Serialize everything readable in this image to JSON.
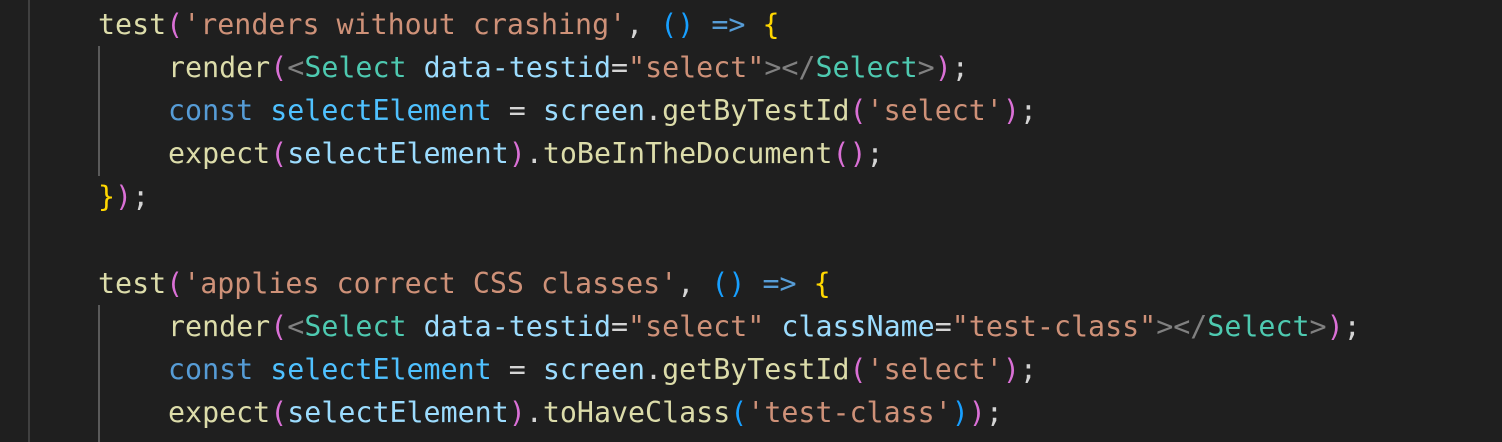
{
  "lines": [
    [
      {
        "text": "test",
        "color": "#dcdcaa"
      },
      {
        "text": "(",
        "color": "#da70d6"
      },
      {
        "text": "'renders without crashing'",
        "color": "#ce9178"
      },
      {
        "text": ", ",
        "color": "#d4d4d4"
      },
      {
        "text": "()",
        "color": "#179fff"
      },
      {
        "text": " ",
        "color": "#d4d4d4"
      },
      {
        "text": "=>",
        "color": "#569cd6"
      },
      {
        "text": " ",
        "color": "#d4d4d4"
      },
      {
        "text": "{",
        "color": "#ffd700"
      }
    ],
    [
      {
        "text": "render",
        "color": "#dcdcaa"
      },
      {
        "text": "(",
        "color": "#da70d6"
      },
      {
        "text": "<",
        "color": "#808080"
      },
      {
        "text": "Select",
        "color": "#4ec9b0"
      },
      {
        "text": " ",
        "color": "#d4d4d4"
      },
      {
        "text": "data-testid",
        "color": "#9cdcfe"
      },
      {
        "text": "=",
        "color": "#d4d4d4"
      },
      {
        "text": "\"select\"",
        "color": "#ce9178"
      },
      {
        "text": "></",
        "color": "#808080"
      },
      {
        "text": "Select",
        "color": "#4ec9b0"
      },
      {
        "text": ">",
        "color": "#808080"
      },
      {
        "text": ")",
        "color": "#da70d6"
      },
      {
        "text": ";",
        "color": "#d4d4d4"
      }
    ],
    [
      {
        "text": "const",
        "color": "#569cd6"
      },
      {
        "text": " ",
        "color": "#d4d4d4"
      },
      {
        "text": "selectElement",
        "color": "#4fc1ff"
      },
      {
        "text": " = ",
        "color": "#d4d4d4"
      },
      {
        "text": "screen",
        "color": "#9cdcfe"
      },
      {
        "text": ".",
        "color": "#d4d4d4"
      },
      {
        "text": "getByTestId",
        "color": "#dcdcaa"
      },
      {
        "text": "(",
        "color": "#da70d6"
      },
      {
        "text": "'select'",
        "color": "#ce9178"
      },
      {
        "text": ")",
        "color": "#da70d6"
      },
      {
        "text": ";",
        "color": "#d4d4d4"
      }
    ],
    [
      {
        "text": "expect",
        "color": "#dcdcaa"
      },
      {
        "text": "(",
        "color": "#da70d6"
      },
      {
        "text": "selectElement",
        "color": "#9cdcfe"
      },
      {
        "text": ")",
        "color": "#da70d6"
      },
      {
        "text": ".",
        "color": "#d4d4d4"
      },
      {
        "text": "toBeInTheDocument",
        "color": "#dcdcaa"
      },
      {
        "text": "()",
        "color": "#da70d6"
      },
      {
        "text": ";",
        "color": "#d4d4d4"
      }
    ],
    [
      {
        "text": "}",
        "color": "#ffd700"
      },
      {
        "text": ")",
        "color": "#da70d6"
      },
      {
        "text": ";",
        "color": "#d4d4d4"
      }
    ],
    [],
    [
      {
        "text": "test",
        "color": "#dcdcaa"
      },
      {
        "text": "(",
        "color": "#da70d6"
      },
      {
        "text": "'applies correct CSS classes'",
        "color": "#ce9178"
      },
      {
        "text": ", ",
        "color": "#d4d4d4"
      },
      {
        "text": "()",
        "color": "#179fff"
      },
      {
        "text": " ",
        "color": "#d4d4d4"
      },
      {
        "text": "=>",
        "color": "#569cd6"
      },
      {
        "text": " ",
        "color": "#d4d4d4"
      },
      {
        "text": "{",
        "color": "#ffd700"
      }
    ],
    [
      {
        "text": "render",
        "color": "#dcdcaa"
      },
      {
        "text": "(",
        "color": "#da70d6"
      },
      {
        "text": "<",
        "color": "#808080"
      },
      {
        "text": "Select",
        "color": "#4ec9b0"
      },
      {
        "text": " ",
        "color": "#d4d4d4"
      },
      {
        "text": "data-testid",
        "color": "#9cdcfe"
      },
      {
        "text": "=",
        "color": "#d4d4d4"
      },
      {
        "text": "\"select\"",
        "color": "#ce9178"
      },
      {
        "text": " ",
        "color": "#d4d4d4"
      },
      {
        "text": "className",
        "color": "#9cdcfe"
      },
      {
        "text": "=",
        "color": "#d4d4d4"
      },
      {
        "text": "\"test-class\"",
        "color": "#ce9178"
      },
      {
        "text": "></",
        "color": "#808080"
      },
      {
        "text": "Select",
        "color": "#4ec9b0"
      },
      {
        "text": ">",
        "color": "#808080"
      },
      {
        "text": ")",
        "color": "#da70d6"
      },
      {
        "text": ";",
        "color": "#d4d4d4"
      }
    ],
    [
      {
        "text": "const",
        "color": "#569cd6"
      },
      {
        "text": " ",
        "color": "#d4d4d4"
      },
      {
        "text": "selectElement",
        "color": "#4fc1ff"
      },
      {
        "text": " = ",
        "color": "#d4d4d4"
      },
      {
        "text": "screen",
        "color": "#9cdcfe"
      },
      {
        "text": ".",
        "color": "#d4d4d4"
      },
      {
        "text": "getByTestId",
        "color": "#dcdcaa"
      },
      {
        "text": "(",
        "color": "#da70d6"
      },
      {
        "text": "'select'",
        "color": "#ce9178"
      },
      {
        "text": ")",
        "color": "#da70d6"
      },
      {
        "text": ";",
        "color": "#d4d4d4"
      }
    ],
    [
      {
        "text": "expect",
        "color": "#dcdcaa"
      },
      {
        "text": "(",
        "color": "#da70d6"
      },
      {
        "text": "selectElement",
        "color": "#9cdcfe"
      },
      {
        "text": ")",
        "color": "#da70d6"
      },
      {
        "text": ".",
        "color": "#d4d4d4"
      },
      {
        "text": "toHaveClass",
        "color": "#dcdcaa"
      },
      {
        "text": "(",
        "color": "#179fff"
      },
      {
        "text": "'test-class'",
        "color": "#ce9178"
      },
      {
        "text": ")",
        "color": "#179fff"
      },
      {
        "text": ")",
        "color": "#da70d6"
      },
      {
        "text": ";",
        "color": "#d4d4d4"
      }
    ]
  ]
}
